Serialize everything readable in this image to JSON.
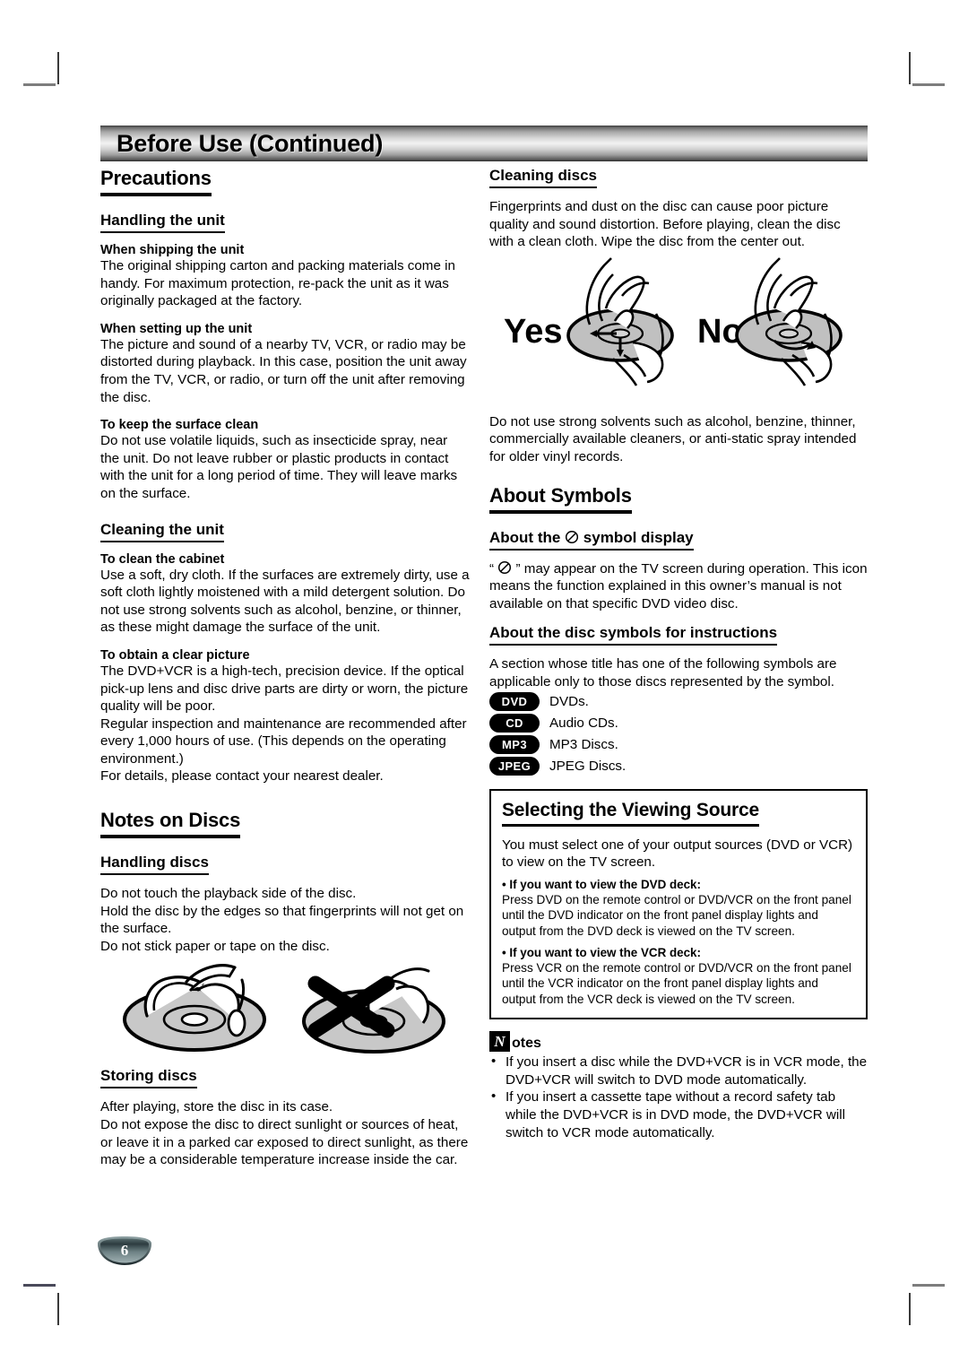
{
  "header": {
    "title": "Before Use (Continued)"
  },
  "page_number": "6",
  "left_column": {
    "precautions": {
      "heading": "Precautions",
      "handling_the_unit": {
        "heading": "Handling the unit",
        "items": [
          {
            "title": "When shipping the unit",
            "body": "The original shipping carton and packing materials come in handy. For maximum protection, re-pack the unit as it was originally packaged at the factory."
          },
          {
            "title": "When setting up the unit",
            "body": "The picture and sound of a nearby TV, VCR, or radio may be distorted during playback. In this case, position the unit away from the TV, VCR, or radio, or turn off the unit after removing the disc."
          },
          {
            "title": "To keep the surface clean",
            "body": "Do not use volatile liquids, such as insecticide spray, near the unit. Do not leave rubber or plastic products in contact with the unit for a long period of time. They will leave marks on the surface."
          }
        ]
      },
      "cleaning_the_unit": {
        "heading": "Cleaning the unit",
        "items": [
          {
            "title": "To clean the cabinet",
            "body": "Use a soft, dry cloth. If the surfaces are extremely dirty, use a soft cloth lightly moistened with a mild detergent solution. Do not use strong solvents such as alcohol, benzine, or thinner, as these might damage the surface of the unit."
          },
          {
            "title": "To obtain a clear picture",
            "body": "The DVD+VCR is a high-tech, precision device. If the optical pick-up lens and disc drive parts are dirty or worn, the picture quality will be poor.\nRegular inspection and maintenance are recommended after every 1,000 hours of use. (This depends on the operating environment.)\nFor details, please contact your nearest dealer."
          }
        ]
      }
    },
    "notes_on_discs": {
      "heading": "Notes on Discs",
      "handling_discs": {
        "heading": "Handling discs",
        "body": "Do not touch the playback side of the disc.\nHold the disc by the edges so that fingerprints will not get on the surface.\nDo not stick paper or tape on the disc."
      },
      "storing_discs": {
        "heading": "Storing discs",
        "body": "After playing, store the disc in its case.\nDo not expose the disc to direct sunlight or sources of heat, or leave it in a parked car exposed to direct sunlight, as there may be a considerable temperature increase inside the car."
      },
      "illustration_alt": "hand-holding-disc-by-edges-correct, disc-touched-on-surface-crossed-out"
    }
  },
  "right_column": {
    "cleaning_discs": {
      "heading": "Cleaning discs",
      "body": "Fingerprints and dust on the disc can cause poor picture quality and sound distortion. Before playing, clean the disc with a clean cloth. Wipe the disc from the center out.",
      "yes_label": "Yes",
      "no_label": "No",
      "footer": "Do not use strong solvents such as alcohol, benzine, thinner, commercially available cleaners, or anti-static spray intended for older vinyl records."
    },
    "about_symbols": {
      "heading": "About Symbols",
      "symbol_display": {
        "heading_prefix": "About the",
        "heading_suffix": "symbol display",
        "body_prefix": "“",
        "body_suffix": "” may appear on the TV screen during operation. This icon means the function explained in this owner’s manual is not available on that specific DVD video disc."
      },
      "disc_symbols": {
        "heading": "About the disc symbols for instructions",
        "intro": "A section whose title has one of the following symbols are applicable only to those discs represented by the symbol.",
        "rows": [
          {
            "badge": "DVD",
            "label": "DVDs."
          },
          {
            "badge": "CD",
            "label": "Audio CDs."
          },
          {
            "badge": "MP3",
            "label": "MP3 Discs."
          },
          {
            "badge": "JPEG",
            "label": "JPEG Discs."
          }
        ]
      }
    },
    "viewing_source": {
      "heading": "Selecting the Viewing Source",
      "intro": "You must select one of your output sources (DVD or VCR) to view on the TV screen.",
      "dvd_bullet": "•  If you want to view the DVD deck:",
      "dvd_body": "Press DVD on the remote control or DVD/VCR on the front panel until the DVD indicator on the front panel display lights and output from the DVD deck is viewed on the TV screen.",
      "vcr_bullet": "•  If you want to view the VCR deck:",
      "vcr_body": "Press VCR on the remote control or DVD/VCR on the front panel until the VCR indicator on the front panel display lights and output from the VCR deck is viewed on the TV screen."
    },
    "notes": {
      "icon_letter": "N",
      "heading_rest": "otes",
      "items": [
        "If you insert a disc while the DVD+VCR is in VCR mode, the DVD+VCR will switch to DVD mode automatically.",
        "If you insert a cassette tape without a record safety tab while the DVD+VCR is in DVD mode, the DVD+VCR will switch to VCR mode automatically."
      ]
    }
  }
}
